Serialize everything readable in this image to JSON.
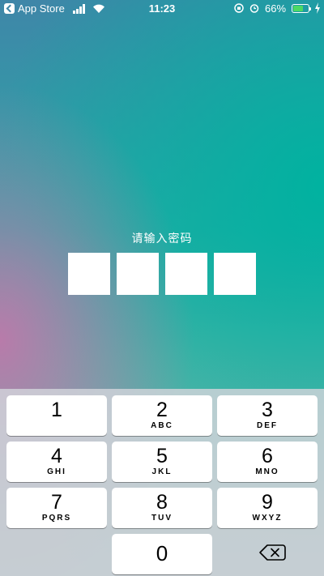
{
  "status_bar": {
    "back_app": "App Store",
    "time": "11:23",
    "battery_percent": "66%",
    "battery_level": 0.66,
    "battery_color": "#4cd964"
  },
  "passcode": {
    "prompt": "请输入密码",
    "digit_count": 4
  },
  "keypad": {
    "keys": [
      {
        "number": "1",
        "letters": ""
      },
      {
        "number": "2",
        "letters": "ABC"
      },
      {
        "number": "3",
        "letters": "DEF"
      },
      {
        "number": "4",
        "letters": "GHI"
      },
      {
        "number": "5",
        "letters": "JKL"
      },
      {
        "number": "6",
        "letters": "MNO"
      },
      {
        "number": "7",
        "letters": "PQRS"
      },
      {
        "number": "8",
        "letters": "TUV"
      },
      {
        "number": "9",
        "letters": "WXYZ"
      },
      {
        "number": "0",
        "letters": ""
      }
    ],
    "delete_icon": "backspace-icon"
  }
}
